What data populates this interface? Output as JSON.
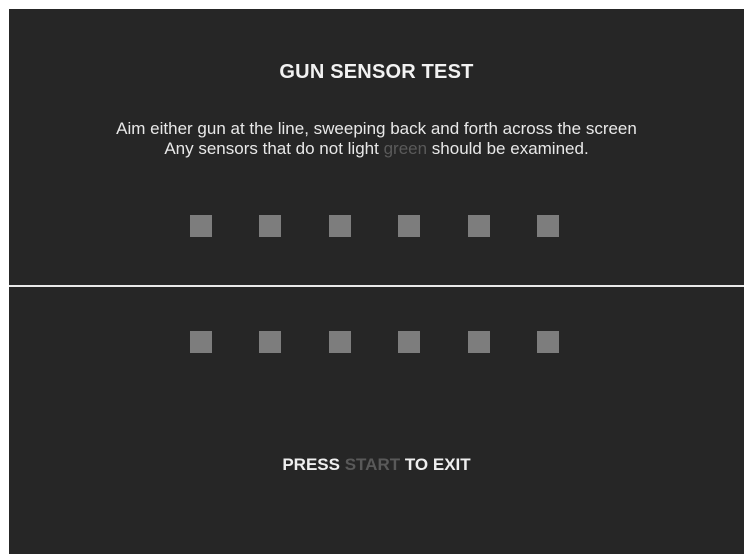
{
  "screen": {
    "title": "GUN SENSOR TEST",
    "instructions": {
      "line1": "Aim either gun at the line, sweeping back and forth across the screen",
      "line2_before": "Any sensors that do not light ",
      "line2_highlight": "green",
      "line2_after": " should be examined."
    },
    "sensors": {
      "top_count": 6,
      "bottom_count": 6,
      "unlit_color": "#7d7d7d",
      "lit_color": "#3cc13c"
    },
    "exit": {
      "before": "PRESS ",
      "highlight": "START",
      "after": " TO EXIT"
    },
    "colors": {
      "background": "#262626",
      "text": "#efefef",
      "dim_text": "#595959",
      "divider": "#e9e9e9"
    }
  }
}
